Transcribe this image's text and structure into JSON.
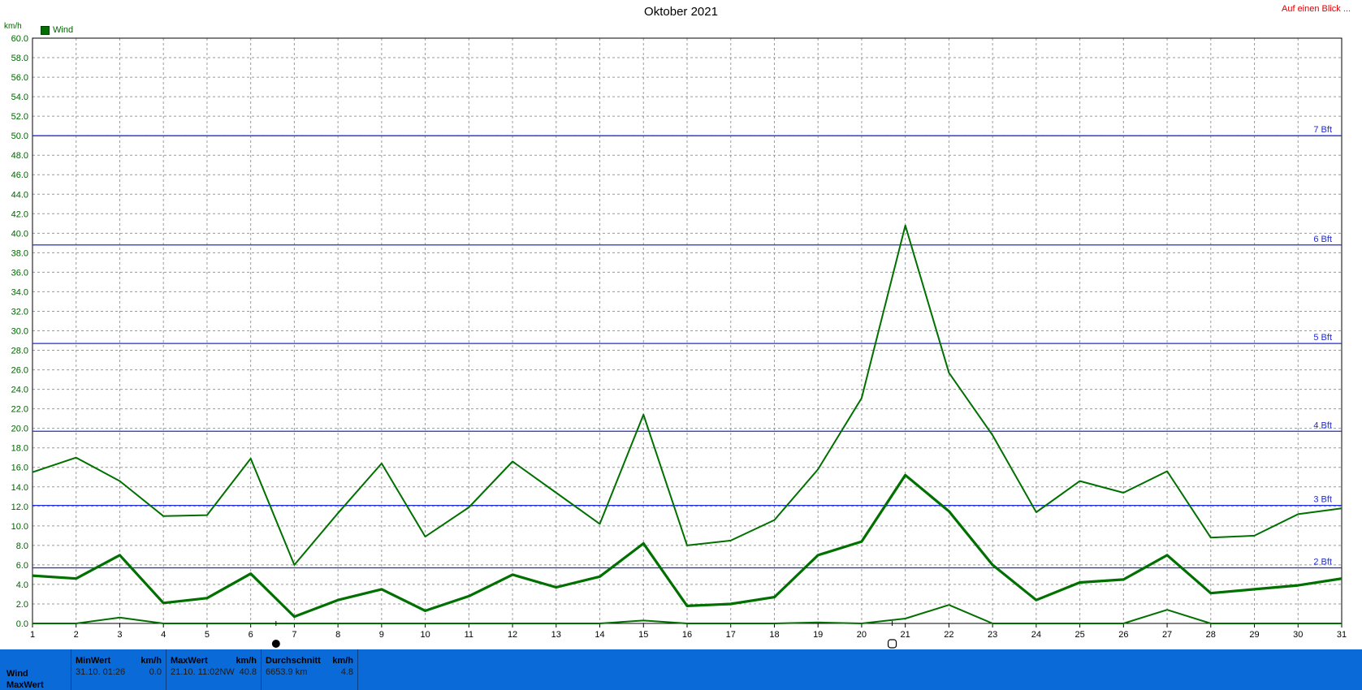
{
  "title": "Oktober 2021",
  "corner_link": "Auf einen Blick ...",
  "unit": "km/h",
  "legend": {
    "label": "Wind",
    "color": "#007000"
  },
  "colors": {
    "line": "#007000",
    "beaufort": "#1f2bd8",
    "grid": "#9a9a9a",
    "panel": "#0a6ad8"
  },
  "chart_data": {
    "type": "line",
    "x": [
      1,
      2,
      3,
      4,
      5,
      6,
      7,
      8,
      9,
      10,
      11,
      12,
      13,
      14,
      15,
      16,
      17,
      18,
      19,
      20,
      21,
      22,
      23,
      24,
      25,
      26,
      27,
      28,
      29,
      30,
      31
    ],
    "xlim": [
      1,
      31
    ],
    "ylim": [
      0,
      60
    ],
    "ytick_step": 2,
    "ylabel": "km/h",
    "grid": true,
    "legend_position": "top-left",
    "series": [
      {
        "name": "Wind",
        "role": "max",
        "values": [
          15.5,
          17.0,
          14.6,
          11.0,
          11.1,
          16.9,
          6.0,
          11.3,
          16.4,
          8.9,
          11.9,
          16.6,
          13.4,
          10.2,
          21.4,
          8.0,
          8.5,
          10.6,
          15.8,
          23.1,
          40.8,
          25.7,
          19.3,
          11.4,
          14.6,
          13.4,
          15.6,
          8.8,
          9.0,
          11.2,
          11.8
        ]
      },
      {
        "name": "Wind",
        "role": "avg",
        "values": [
          4.9,
          4.6,
          7.0,
          2.1,
          2.6,
          5.1,
          0.7,
          2.4,
          3.5,
          1.3,
          2.8,
          5.0,
          3.7,
          4.8,
          8.2,
          1.8,
          2.0,
          2.7,
          7.0,
          8.4,
          15.2,
          11.5,
          6.0,
          2.4,
          4.2,
          4.5,
          7.0,
          3.1,
          3.5,
          3.9,
          4.6
        ]
      },
      {
        "name": "Wind",
        "role": "min",
        "values": [
          0.0,
          0.0,
          0.6,
          0.0,
          0.0,
          0.0,
          0.0,
          0.0,
          0.0,
          0.0,
          0.0,
          0.0,
          0.0,
          0.0,
          0.3,
          0.0,
          0.0,
          0.0,
          0.1,
          0.0,
          0.5,
          1.9,
          0.0,
          0.0,
          0.0,
          0.0,
          1.4,
          0.0,
          0.0,
          0.0,
          0.0
        ]
      }
    ],
    "beaufort_lines": [
      {
        "label": "2 Bft",
        "value": 5.7
      },
      {
        "label": "3 Bft",
        "value": 12.1
      },
      {
        "label": "4 Bft",
        "value": 19.7
      },
      {
        "label": "5 Bft",
        "value": 28.7
      },
      {
        "label": "6 Bft",
        "value": 38.8
      },
      {
        "label": "7 Bft",
        "value": 50.0
      }
    ],
    "markers": [
      {
        "type": "filled",
        "day": 6.58
      },
      {
        "type": "hollow",
        "day": 20.7
      }
    ]
  },
  "stats": {
    "row_labels": [
      "Wind",
      "MaxWert"
    ],
    "min": {
      "header": "MinWert",
      "unit": "km/h",
      "when": "31.10.  01:26",
      "value": "0.0"
    },
    "max": {
      "header": "MaxWert",
      "unit": "km/h",
      "when": "21.10.  11:02NW",
      "value": "40.8"
    },
    "avg": {
      "header": "Durchschnitt",
      "unit": "km/h",
      "when": "6653.9 km",
      "value": "4.8"
    }
  }
}
